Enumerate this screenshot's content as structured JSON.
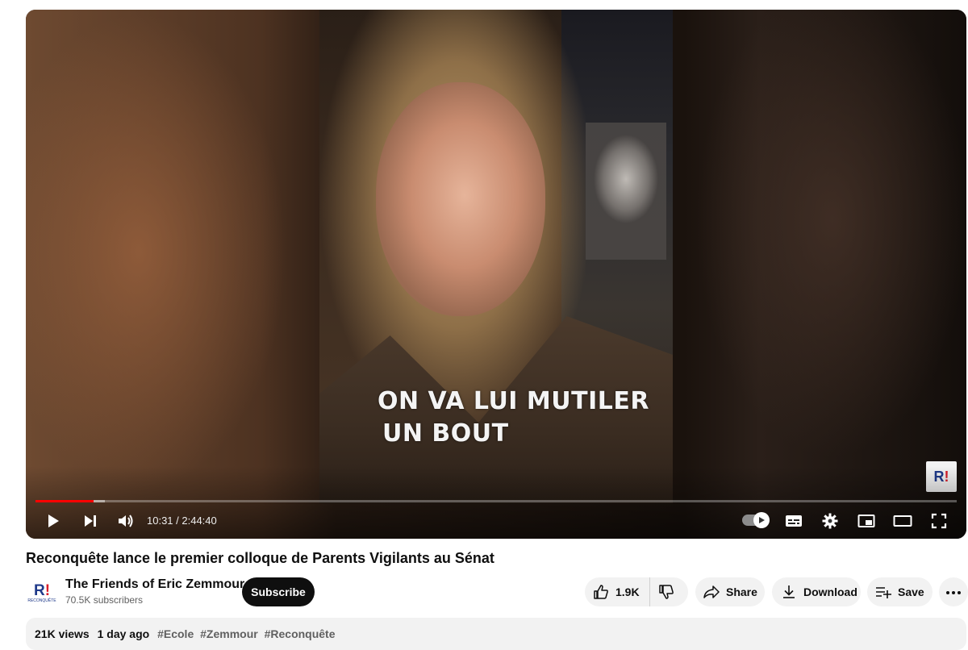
{
  "video": {
    "caption_line1": "ON VA LUI MUTILER",
    "caption_line2": "UN BOUT",
    "watermark_text": "R",
    "watermark_excl": "!",
    "progress_played": 0.063,
    "progress_loaded": 0.075
  },
  "controls": {
    "time": "10:31 / 2:44:40",
    "icons": [
      "play-icon",
      "next-icon",
      "volume-icon",
      "autoplay-toggle-icon",
      "subtitles-icon",
      "settings-icon",
      "miniplayer-icon",
      "theater-icon",
      "fullscreen-icon"
    ]
  },
  "meta": {
    "title": "Reconquête lance le premier colloque de Parents Vigilants au Sénat"
  },
  "channel": {
    "avatar_mark": "R",
    "avatar_excl": "!",
    "avatar_small": "RECONQUÊTE",
    "name": "The Friends of Eric Zemmour",
    "subscribers": "70.5K subscribers",
    "subscribe_label": "Subscribe"
  },
  "actions": {
    "likes": "1.9K",
    "share": "Share",
    "download": "Download",
    "save": "Save"
  },
  "description": {
    "views": "21K views",
    "date": "1 day ago",
    "tags": [
      "#Ecole",
      "#Zemmour",
      "#Reconquête"
    ]
  },
  "colors": {
    "accent_red": "#ff0000",
    "brand_blue": "#1f3a8a",
    "pill_bg": "#f2f2f2"
  }
}
